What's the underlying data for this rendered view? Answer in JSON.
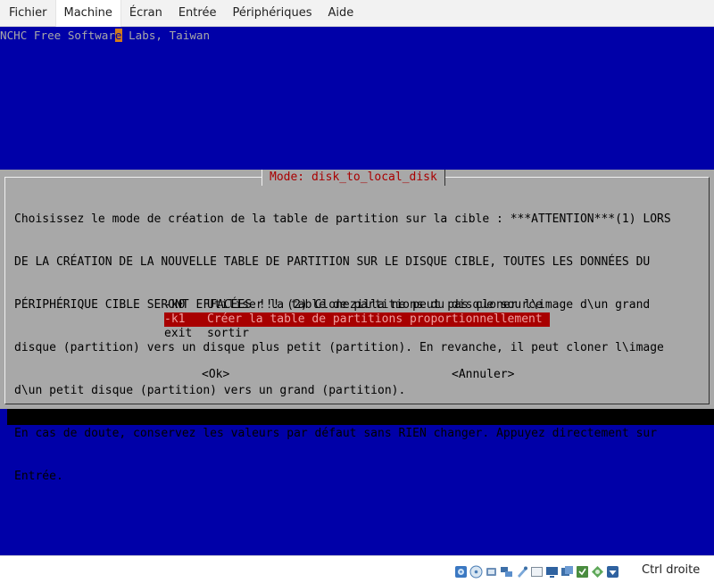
{
  "menubar": {
    "items": [
      "Fichier",
      "Machine",
      "Écran",
      "Entrée",
      "Périphériques",
      "Aide"
    ]
  },
  "console": {
    "banner_before": "NCHC Free Softwar",
    "banner_cursor": "e",
    "banner_after": " Labs, Taiwan"
  },
  "dialog": {
    "title": "Mode: disk_to_local_disk",
    "message_lines": [
      "Choisissez le mode de création de la table de partition sur la cible : ***ATTENTION***(1) LORS",
      "DE LA CRÉATION DE LA NOUVELLE TABLE DE PARTITION SUR LE DISQUE CIBLE, TOUTES LES DONNÉES DU",
      "PÉRIPHÉRIQUE CIBLE SERONT EFFACÉES !!! (2) Clonezilla ne peut pas cloner l\\image d\\un grand",
      "disque (partition) vers un disque plus petit (partition). En revanche, il peut cloner l\\image",
      "d\\un petit disque (partition) vers un grand (partition).",
      "En cas de doute, conservez les valeurs par défaut sans RIEN changer. Appuyez directement sur",
      "Entrée."
    ],
    "options": [
      {
        "key": "-k0",
        "label": "Utiliser la table de partitions du disque source",
        "selected": false
      },
      {
        "key": "-k1",
        "label": "Créer la table de partitions proportionnellement",
        "selected": true
      },
      {
        "key": "exit",
        "label": "sortir",
        "selected": false
      }
    ],
    "ok_label": "<Ok>",
    "cancel_label": "<Annuler>"
  },
  "statusbar": {
    "icons": [
      "hard-disk-icon",
      "optical-disk-icon",
      "audio-icon",
      "network-icon",
      "usb-icon",
      "shared-folder-icon",
      "display-icon",
      "video-capture-icon",
      "cpu-icon",
      "mouse-integration-icon",
      "host-key-arrow-icon"
    ],
    "host_key_label": "Ctrl droite"
  },
  "colors": {
    "console_bg": "#0000a8",
    "dialog_bg": "#a8a8a8",
    "title_color": "#a80000",
    "selection_bg": "#a80000"
  }
}
